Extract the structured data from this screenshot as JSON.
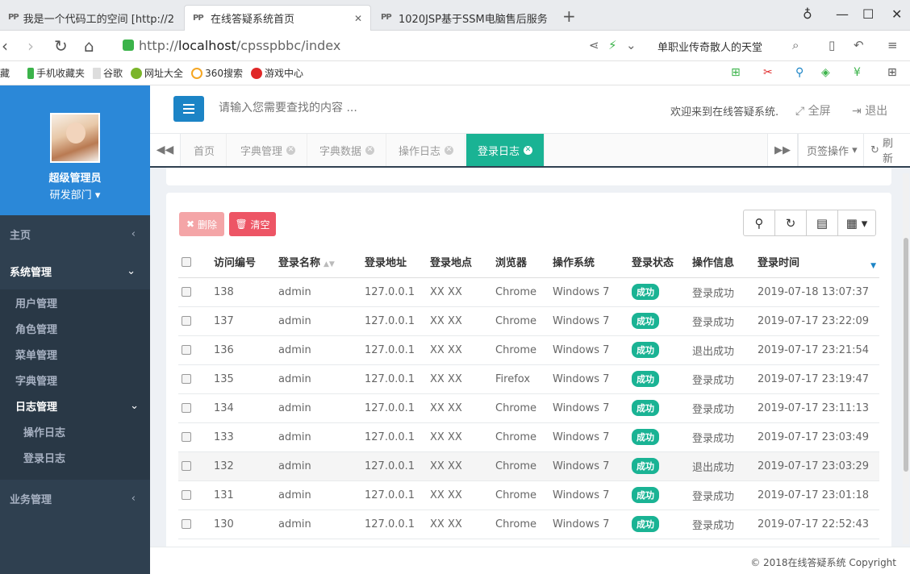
{
  "browser": {
    "tabs": [
      {
        "title": "我是一个代码工的空间 [http://2"
      },
      {
        "title": "在线答疑系统首页"
      },
      {
        "title": "1020JSP基于SSM电脑售后服务"
      }
    ],
    "url_prefix": "http://",
    "url_host": "localhost",
    "url_path": "/cpsspbbc/index",
    "search_hint": "单职业传奇散人的天堂",
    "bookmarks": [
      "藏",
      "手机收藏夹",
      "谷歌",
      "网址大全",
      "360搜索",
      "游戏中心"
    ]
  },
  "sidebar": {
    "user_name": "超级管理员",
    "department": "研发部门",
    "menu": {
      "home": "主页",
      "system": "系统管理",
      "system_items": [
        "用户管理",
        "角色管理",
        "菜单管理",
        "字典管理"
      ],
      "log": "日志管理",
      "log_items": [
        "操作日志",
        "登录日志"
      ],
      "business": "业务管理"
    }
  },
  "header": {
    "search_placeholder": "请输入您需要查找的内容 ...",
    "welcome": "欢迎来到在线答疑系统.",
    "fullscreen": "全屏",
    "logout": "退出"
  },
  "content_tabs": {
    "items": [
      "首页",
      "字典管理",
      "字典数据",
      "操作日志",
      "登录日志"
    ],
    "page_ops": "页签操作",
    "refresh": "刷新"
  },
  "toolbar": {
    "delete": "删除",
    "clear": "清空"
  },
  "table": {
    "headers": [
      "访问编号",
      "登录名称",
      "登录地址",
      "登录地点",
      "浏览器",
      "操作系统",
      "登录状态",
      "操作信息",
      "登录时间"
    ],
    "rows": [
      {
        "id": "138",
        "name": "admin",
        "ip": "127.0.0.1",
        "loc": "XX XX",
        "browser": "Chrome",
        "os": "Windows 7",
        "status": "成功",
        "msg": "登录成功",
        "time": "2019-07-18 13:07:37"
      },
      {
        "id": "137",
        "name": "admin",
        "ip": "127.0.0.1",
        "loc": "XX XX",
        "browser": "Chrome",
        "os": "Windows 7",
        "status": "成功",
        "msg": "登录成功",
        "time": "2019-07-17 23:22:09"
      },
      {
        "id": "136",
        "name": "admin",
        "ip": "127.0.0.1",
        "loc": "XX XX",
        "browser": "Chrome",
        "os": "Windows 7",
        "status": "成功",
        "msg": "退出成功",
        "time": "2019-07-17 23:21:54"
      },
      {
        "id": "135",
        "name": "admin",
        "ip": "127.0.0.1",
        "loc": "XX XX",
        "browser": "Firefox",
        "os": "Windows 7",
        "status": "成功",
        "msg": "登录成功",
        "time": "2019-07-17 23:19:47"
      },
      {
        "id": "134",
        "name": "admin",
        "ip": "127.0.0.1",
        "loc": "XX XX",
        "browser": "Chrome",
        "os": "Windows 7",
        "status": "成功",
        "msg": "登录成功",
        "time": "2019-07-17 23:11:13"
      },
      {
        "id": "133",
        "name": "admin",
        "ip": "127.0.0.1",
        "loc": "XX XX",
        "browser": "Chrome",
        "os": "Windows 7",
        "status": "成功",
        "msg": "登录成功",
        "time": "2019-07-17 23:03:49"
      },
      {
        "id": "132",
        "name": "admin",
        "ip": "127.0.0.1",
        "loc": "XX XX",
        "browser": "Chrome",
        "os": "Windows 7",
        "status": "成功",
        "msg": "退出成功",
        "time": "2019-07-17 23:03:29"
      },
      {
        "id": "131",
        "name": "admin",
        "ip": "127.0.0.1",
        "loc": "XX XX",
        "browser": "Chrome",
        "os": "Windows 7",
        "status": "成功",
        "msg": "登录成功",
        "time": "2019-07-17 23:01:18"
      },
      {
        "id": "130",
        "name": "admin",
        "ip": "127.0.0.1",
        "loc": "XX XX",
        "browser": "Chrome",
        "os": "Windows 7",
        "status": "成功",
        "msg": "登录成功",
        "time": "2019-07-17 22:52:43"
      }
    ]
  },
  "footer": {
    "copyright": "© 2018在线答疑系统 Copyright"
  },
  "colors": {
    "sidebar_bg": "#2f4050",
    "profile_bg": "#2b88d8",
    "accent": "#1ab394",
    "danger": "#ed5565",
    "primary": "#1c84c6"
  }
}
